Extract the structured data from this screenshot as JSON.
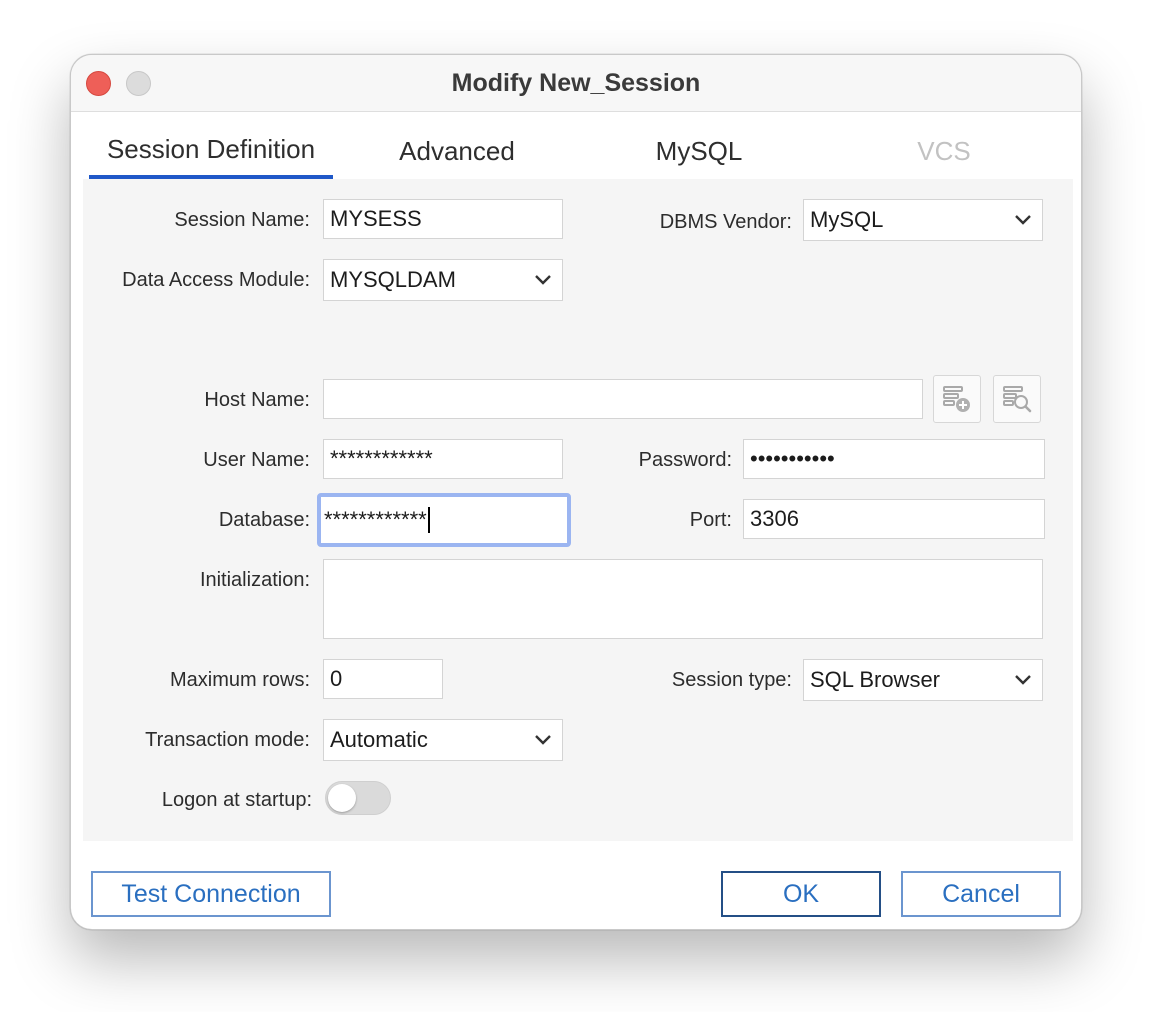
{
  "window": {
    "title": "Modify New_Session"
  },
  "tabs": [
    {
      "label": "Session Definition",
      "active": true
    },
    {
      "label": "Advanced"
    },
    {
      "label": "MySQL"
    },
    {
      "label": "VCS",
      "disabled": true
    }
  ],
  "form": {
    "session_name": {
      "label": "Session Name:",
      "value": "MYSESS"
    },
    "dbms_vendor": {
      "label": "DBMS Vendor:",
      "value": "MySQL"
    },
    "data_access_module": {
      "label": "Data Access Module:",
      "value": "MYSQLDAM"
    },
    "host_name": {
      "label": "Host Name:",
      "value": ""
    },
    "user_name": {
      "label": "User Name:",
      "value": "************"
    },
    "password": {
      "label": "Password:",
      "value": "•••••••••••"
    },
    "database": {
      "label": "Database:",
      "value": "************"
    },
    "port": {
      "label": "Port:",
      "value": "3306"
    },
    "initialization": {
      "label": "Initialization:",
      "value": ""
    },
    "maximum_rows": {
      "label": "Maximum rows:",
      "value": "0"
    },
    "session_type": {
      "label": "Session type:",
      "value": "SQL Browser"
    },
    "transaction_mode": {
      "label": "Transaction mode:",
      "value": "Automatic"
    },
    "logon_at_startup": {
      "label": "Logon at startup:",
      "on": false
    }
  },
  "icons": {
    "add_host": "database-add-icon",
    "browse_host": "database-search-icon"
  },
  "buttons": {
    "test_connection": "Test Connection",
    "ok": "OK",
    "cancel": "Cancel"
  },
  "colors": {
    "accent": "#1f58c8",
    "button_text": "#2a6fc0",
    "close": "#ee5f58",
    "focus_ring": "#9bb5f1"
  }
}
